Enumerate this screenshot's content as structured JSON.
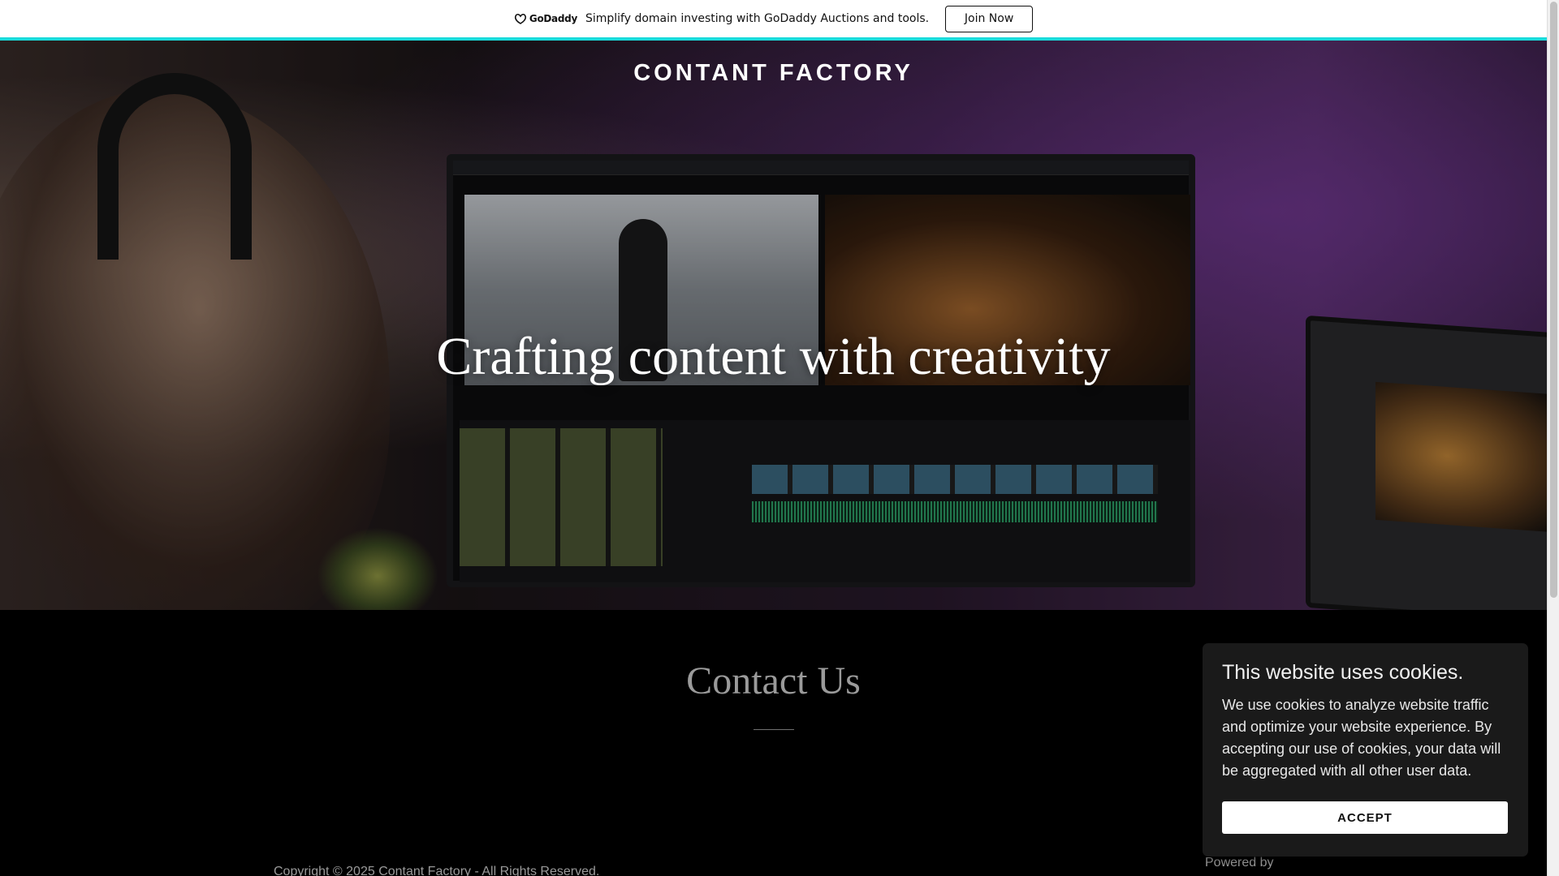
{
  "promo": {
    "logo_text": "GoDaddy",
    "message": "Simplify domain investing with GoDaddy Auctions and tools.",
    "button_label": "Join Now"
  },
  "site": {
    "title": "CONTANT FACTORY",
    "tagline": "Crafting content with creativity"
  },
  "contact": {
    "heading": "Contact Us"
  },
  "footer": {
    "copyright": "Copyright © 2025 Contant Factory - All Rights Reserved.",
    "powered_by": "Powered by"
  },
  "cookie": {
    "title": "This website uses cookies.",
    "body": "We use cookies to analyze website traffic and optimize your website experience. By accepting our use of cookies, your data will be aggregated with all other user data.",
    "accept_label": "ACCEPT"
  },
  "colors": {
    "accent_line": "#1bdbdb",
    "background": "#000000"
  },
  "icons": {
    "logo": "godaddy-logo-icon"
  }
}
